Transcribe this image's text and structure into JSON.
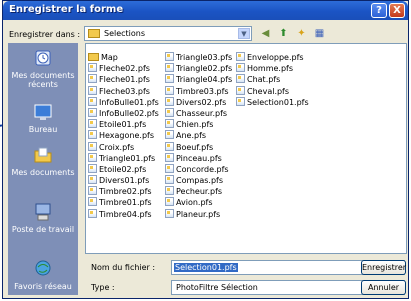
{
  "dialog": {
    "title": "Enregistrer la forme",
    "help_label": "?",
    "close_label": "X"
  },
  "location": {
    "label": "Enregistrer dans :",
    "current": "Selections"
  },
  "places": [
    {
      "label": "Mes documents récents",
      "icon": "recent-documents-icon"
    },
    {
      "label": "Bureau",
      "icon": "desktop-icon"
    },
    {
      "label": "Mes documents",
      "icon": "my-documents-icon"
    },
    {
      "label": "Poste de travail",
      "icon": "my-computer-icon"
    },
    {
      "label": "Favoris réseau",
      "icon": "network-places-icon"
    }
  ],
  "files": {
    "col1": [
      "Map",
      "Fleche02.pfs",
      "Fleche01.pfs",
      "Fleche03.pfs",
      "InfoBulle01.pfs",
      "InfoBulle02.pfs",
      "Etoile01.pfs",
      "Hexagone.pfs",
      "Croix.pfs",
      "Triangle01.pfs",
      "Etoile02.pfs",
      "Divers01.pfs",
      "Timbre02.pfs",
      "Timbre01.pfs",
      "Timbre04.pfs"
    ],
    "col2": [
      "Triangle03.pfs",
      "Triangle02.pfs",
      "Triangle04.pfs",
      "Timbre03.pfs",
      "Divers02.pfs",
      "Chasseur.pfs",
      "Chien.pfs",
      "Ane.pfs",
      "Boeuf.pfs",
      "Pinceau.pfs",
      "Concorde.pfs",
      "Compas.pfs",
      "Pecheur.pfs",
      "Avion.pfs",
      "Planeur.pfs"
    ],
    "col3": [
      "Enveloppe.pfs",
      "Homme.pfs",
      "Chat.pfs",
      "Cheval.pfs",
      "Selection01.pfs"
    ]
  },
  "filename": {
    "label": "Nom du fichier :",
    "value": "Selection01.pfs"
  },
  "filetype": {
    "label": "Type :",
    "value": "PhotoFiltre Sélection"
  },
  "buttons": {
    "save": "Enregistrer",
    "cancel": "Annuler"
  },
  "colors": {
    "title_bar": "#1b54c4",
    "places_bar": "#7e8fb7",
    "selection": "#316ac5"
  }
}
